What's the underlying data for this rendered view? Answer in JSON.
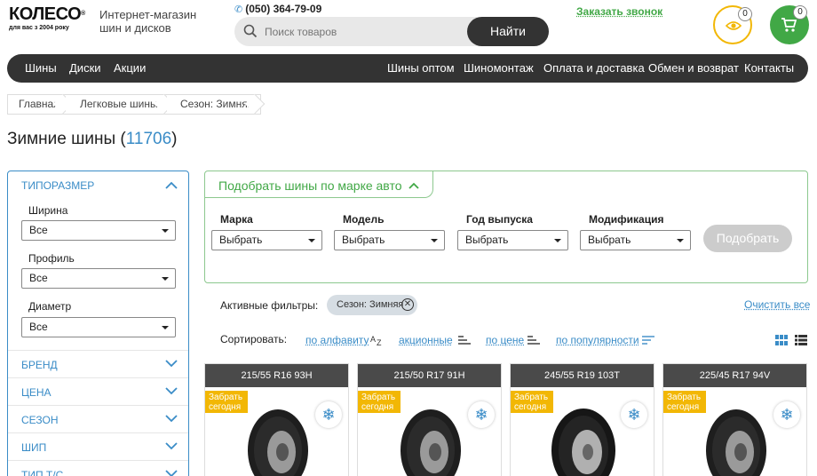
{
  "header": {
    "logo_main": "КОЛЕСО",
    "logo_reg": "®",
    "logo_sub": "для вас з 2004 року",
    "tagline_line1": "Интернет-магазин",
    "tagline_line2": "шин и дисков",
    "phone": "(050) 364-79-09",
    "search_placeholder": "Поиск товаров",
    "search_button": "Найти",
    "callback": "Заказать звонок",
    "viewed_count": "0",
    "cart_count": "0"
  },
  "nav": {
    "left": [
      "Шины",
      "Диски",
      "Акции"
    ],
    "right": [
      "Шины оптом",
      "Шиномонтаж",
      "Оплата и доставка",
      "Обмен и возврат",
      "Контакты"
    ]
  },
  "breadcrumb": [
    "Главная",
    "Легковые шины",
    "Сезон: Зимняя"
  ],
  "title": {
    "text": "Зимние шины",
    "open": "(",
    "count": "11706",
    "close": ")"
  },
  "sidebar": {
    "size_section": "ТИПОРАЗМЕР",
    "width_label": "Ширина",
    "width_value": "Все",
    "profile_label": "Профиль",
    "profile_value": "Все",
    "diameter_label": "Диаметр",
    "diameter_value": "Все",
    "sections": [
      "БРЕНД",
      "ЦЕНА",
      "СЕЗОН",
      "ШИП",
      "ТИП Т/С"
    ]
  },
  "picker": {
    "title": "Подобрать шины по марке авто",
    "fields": [
      {
        "label": "Марка",
        "value": "Выбрать"
      },
      {
        "label": "Модель",
        "value": "Выбрать"
      },
      {
        "label": "Год выпуска",
        "value": "Выбрать"
      },
      {
        "label": "Модификация",
        "value": "Выбрать"
      }
    ],
    "button": "Подобрать"
  },
  "filters": {
    "label": "Активные фильтры:",
    "chip": "Сезон: Зимняя",
    "clear": "Очистить все"
  },
  "sort": {
    "label": "Сортировать:",
    "options": [
      "по алфавиту",
      "акционные",
      "по цене",
      "по популярности"
    ]
  },
  "products": [
    {
      "size": "215/55 R16 93H",
      "promo": "Забрать сегодня"
    },
    {
      "size": "215/50 R17 91H",
      "promo": "Забрать сегодня"
    },
    {
      "size": "245/55 R19 103T",
      "promo": "Забрать сегодня"
    },
    {
      "size": "225/45 R17 94V",
      "promo": "Забрать сегодня"
    }
  ],
  "colors": {
    "accent_green": "#41a846",
    "accent_blue": "#3a8cc7",
    "accent_yellow": "#f2b705",
    "dark": "#333333"
  }
}
